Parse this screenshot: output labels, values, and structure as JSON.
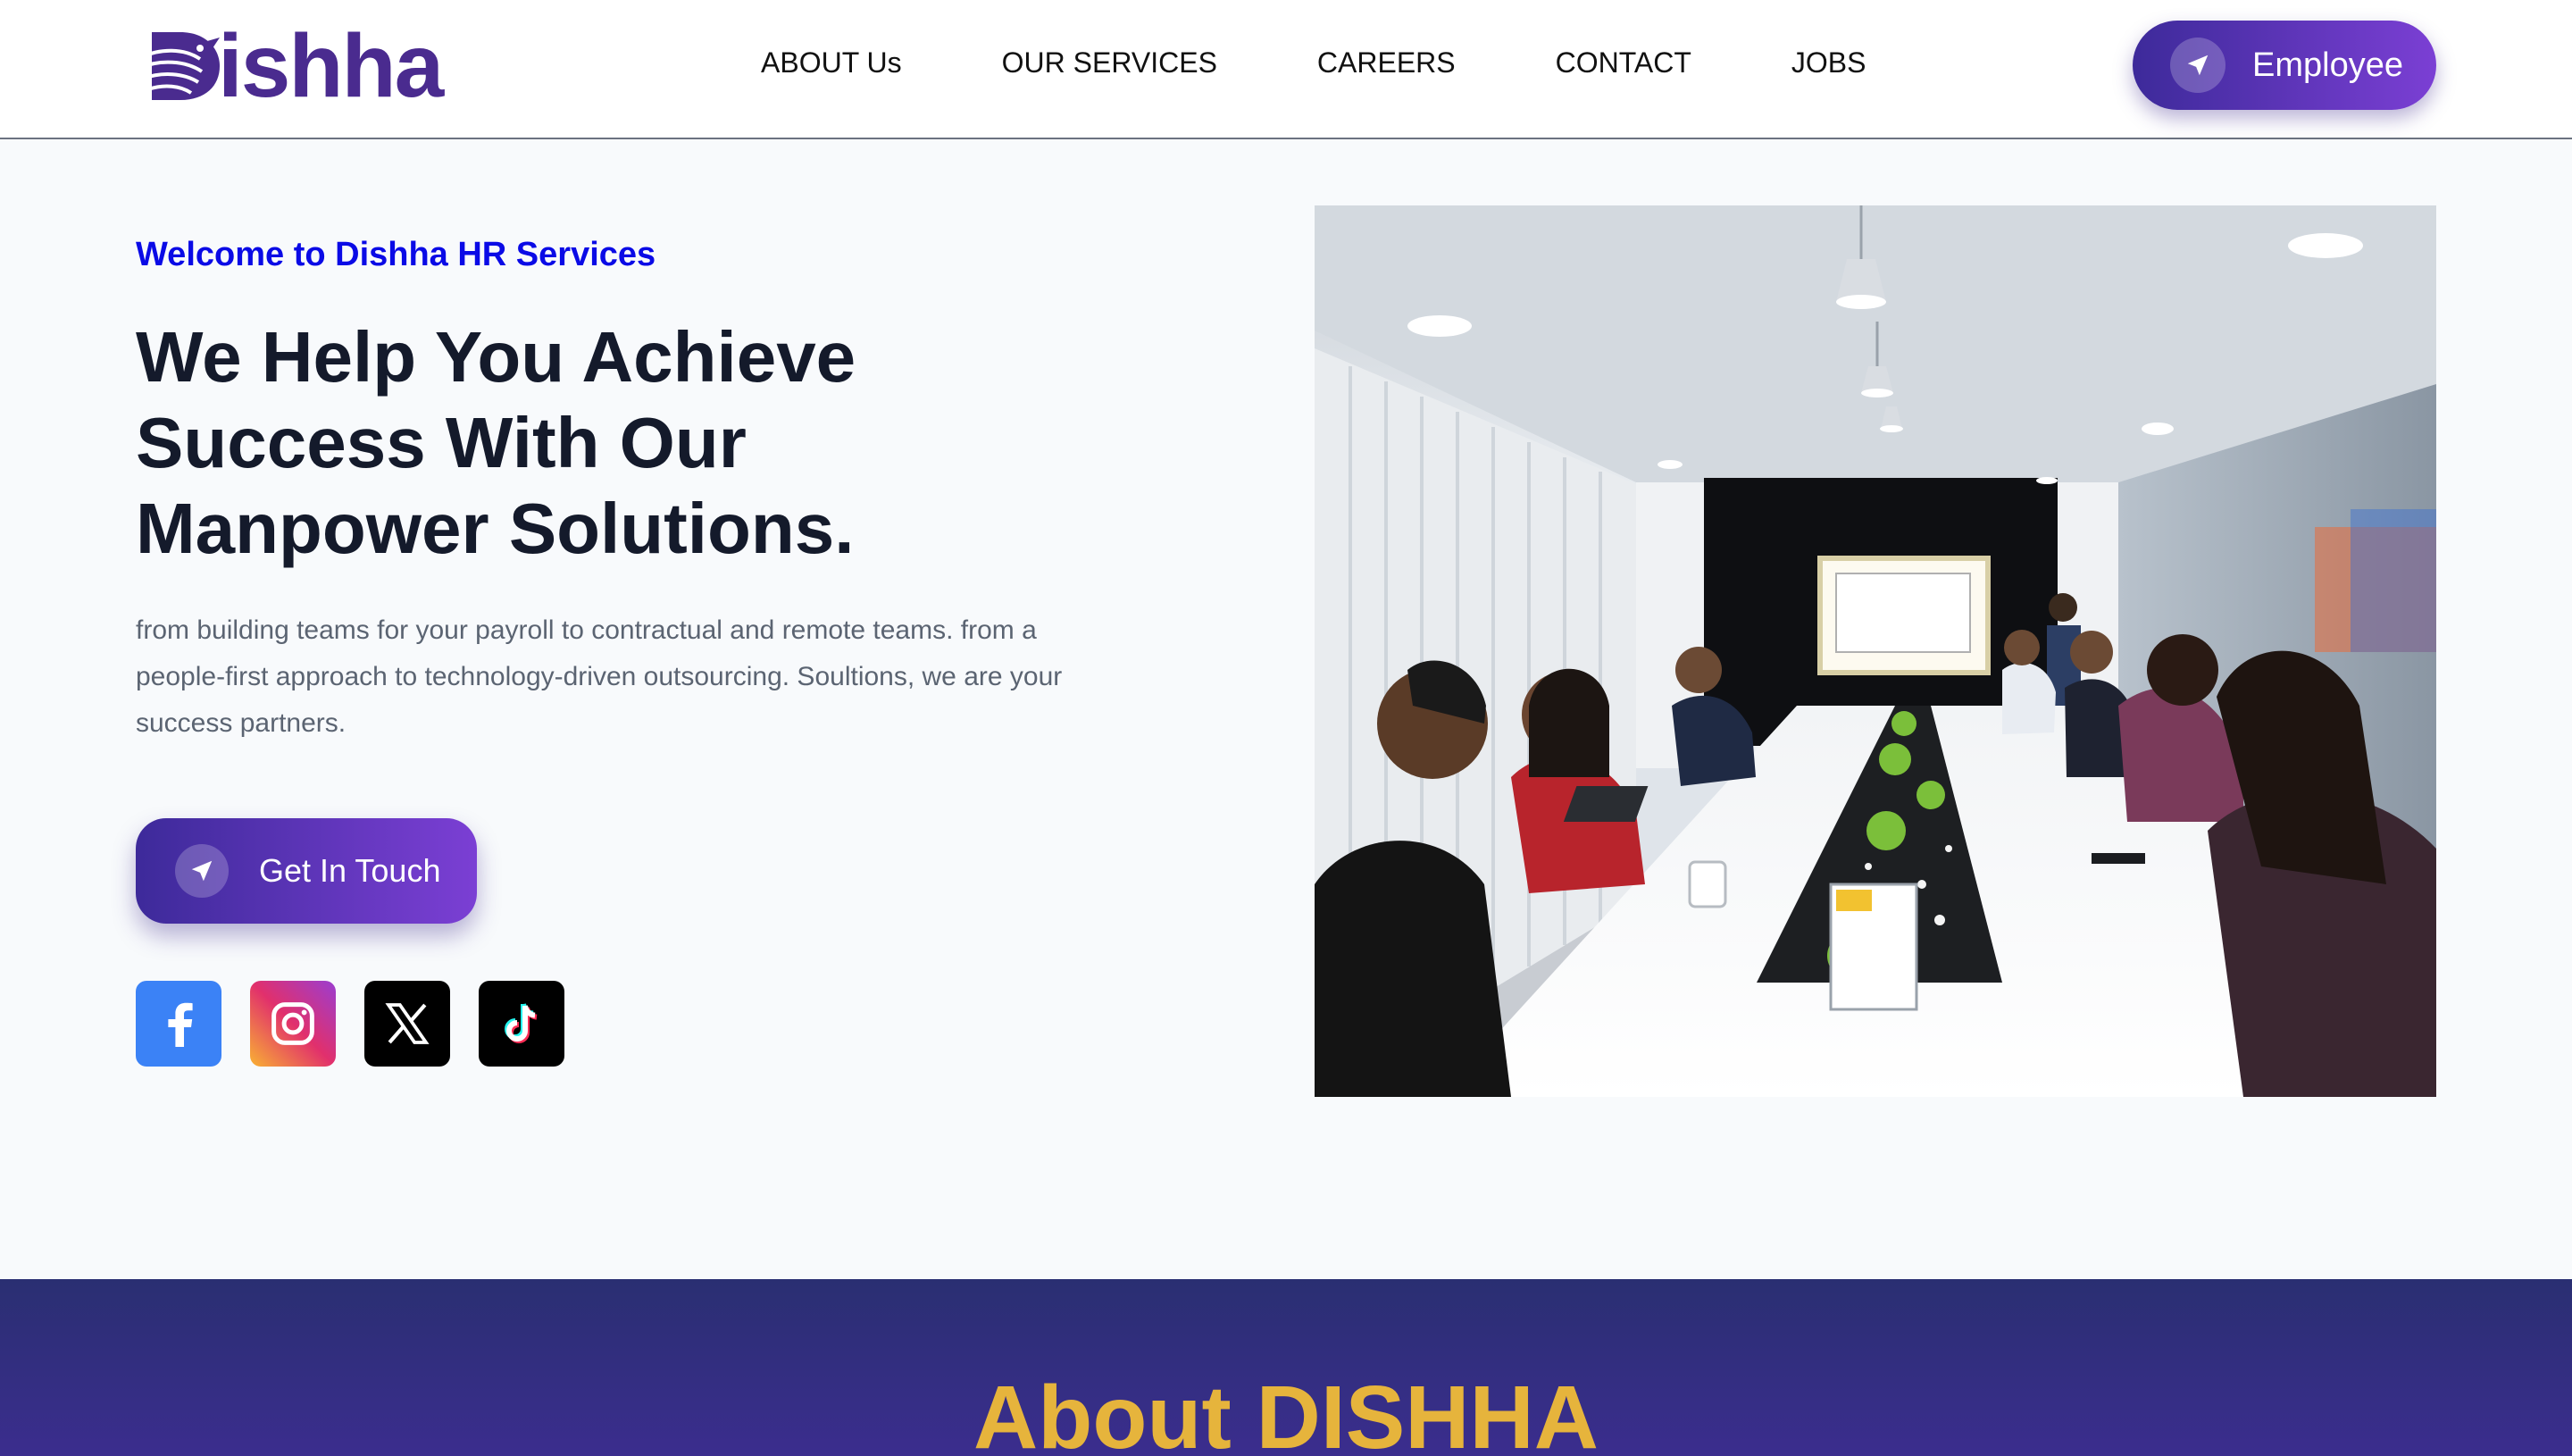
{
  "header": {
    "logo_text": "ishha",
    "logo_full": "Dishha",
    "nav": [
      {
        "label": "ABOUT Us"
      },
      {
        "label": "OUR SERVICES"
      },
      {
        "label": "CAREERS"
      },
      {
        "label": "CONTACT"
      },
      {
        "label": "JOBS"
      }
    ],
    "employee_button": "Employee"
  },
  "hero": {
    "welcome": "Welcome to Dishha HR Services",
    "headline_lines": [
      "We Help You Achieve",
      "Success With Our",
      "Manpower Solutions."
    ],
    "description": "from building teams for your payroll to contractual and remote teams. from a people-first approach to technology-driven outsourcing. Soultions, we are your success partners.",
    "cta": "Get In Touch",
    "socials": [
      {
        "name": "facebook",
        "icon": "facebook-icon",
        "color": "#3b82f6"
      },
      {
        "name": "instagram",
        "icon": "instagram-icon",
        "color": "#e1306c"
      },
      {
        "name": "x",
        "icon": "x-icon",
        "color": "#000000"
      },
      {
        "name": "tiktok",
        "icon": "tiktok-icon",
        "color": "#000000"
      }
    ]
  },
  "about": {
    "title": "About DISHHA"
  },
  "colors": {
    "brand": "#4a2b8f",
    "welcome": "#0a0ae6",
    "button_gradient_start": "#3d2a9a",
    "button_gradient_end": "#7b3fd4",
    "about_bg": "#2a2f72",
    "about_title": "#e6b43c"
  }
}
